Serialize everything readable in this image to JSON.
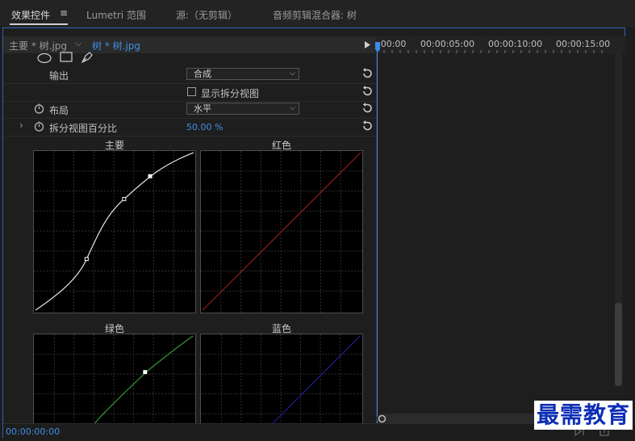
{
  "tabs": [
    {
      "label": "效果控件"
    },
    {
      "label": "Lumetri 范围"
    },
    {
      "label": "源:（无剪辑）"
    },
    {
      "label": "音频剪辑混合器: 树"
    }
  ],
  "tabs_menu_glyph": "≡",
  "sequence": {
    "master": "主要 * 树.jpg",
    "clip": "树 * 树.jpg"
  },
  "properties": {
    "output_label": "输出",
    "output_value": "合成",
    "split_view_label": "显示拆分视图",
    "layout_label": "布局",
    "layout_value": "水平",
    "split_percent_label": "拆分视图百分比",
    "split_percent_value": "50.00 %"
  },
  "curves": {
    "master": "主要",
    "red": "红色",
    "green": "绿色",
    "blue": "蓝色"
  },
  "timeline": {
    "ticks": [
      ":00:00",
      "00:00:05:00",
      "00:00:10:00",
      "00:00:15:00"
    ]
  },
  "footer": {
    "timecode": "00:00:00:00"
  },
  "watermark": "最需教育",
  "colors": {
    "accent": "#2d8ceb",
    "red_curve": "#8a1a1a",
    "green_curve": "#2f8f2f",
    "blue_curve": "#1c1c8a"
  }
}
